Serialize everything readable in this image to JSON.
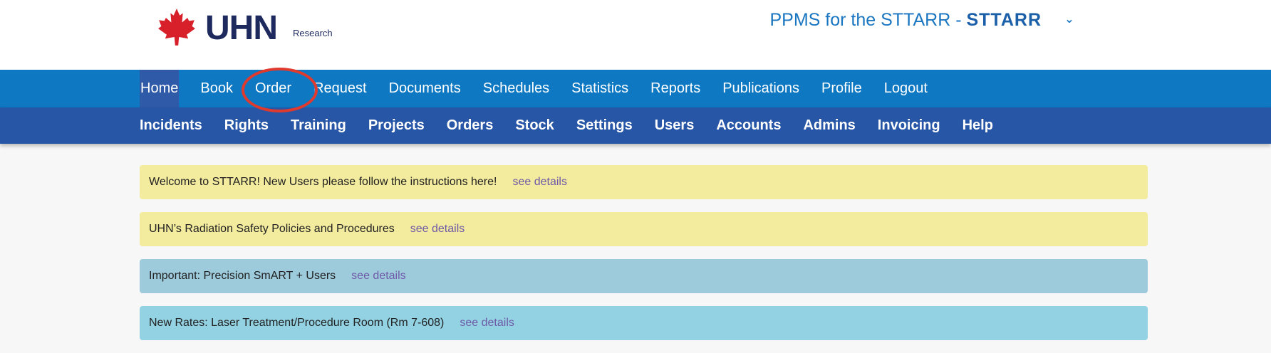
{
  "header": {
    "logo_text": "UHN",
    "logo_subtitle": "Research",
    "facility_prefix": "PPMS for the STTARR - ",
    "facility_name": "STTARR",
    "chevron_icon": "chevron-down-icon"
  },
  "nav_primary": [
    {
      "label": "Home"
    },
    {
      "label": "Book"
    },
    {
      "label": "Order"
    },
    {
      "label": "Request"
    },
    {
      "label": "Documents"
    },
    {
      "label": "Schedules"
    },
    {
      "label": "Statistics"
    },
    {
      "label": "Reports"
    },
    {
      "label": "Publications"
    },
    {
      "label": "Profile"
    },
    {
      "label": "Logout"
    }
  ],
  "nav_secondary": [
    {
      "label": "Incidents"
    },
    {
      "label": "Rights"
    },
    {
      "label": "Training"
    },
    {
      "label": "Projects"
    },
    {
      "label": "Orders"
    },
    {
      "label": "Stock"
    },
    {
      "label": "Settings"
    },
    {
      "label": "Users"
    },
    {
      "label": "Accounts"
    },
    {
      "label": "Admins"
    },
    {
      "label": "Invoicing"
    },
    {
      "label": "Help"
    }
  ],
  "notices": [
    {
      "text": "Welcome to STTARR! New Users please follow the instructions here!",
      "link": "see details",
      "color": "#f3eb9e"
    },
    {
      "text": "UHN’s Radiation Safety Policies and Procedures",
      "link": "see details",
      "color": "#f3eb9e"
    },
    {
      "text": "Important: Precision SmART + Users",
      "link": "see details",
      "color": "#9dcbdc"
    },
    {
      "text": "New Rates: Laser Treatment/Procedure Room (Rm 7-608)",
      "link": "see details",
      "color": "#93d2e2"
    }
  ],
  "colors": {
    "nav_primary_bg": "#0e78c2",
    "nav_secondary_bg": "#2756a6",
    "annotation_circle": "#e03a2f",
    "link": "#6f5aa8"
  }
}
